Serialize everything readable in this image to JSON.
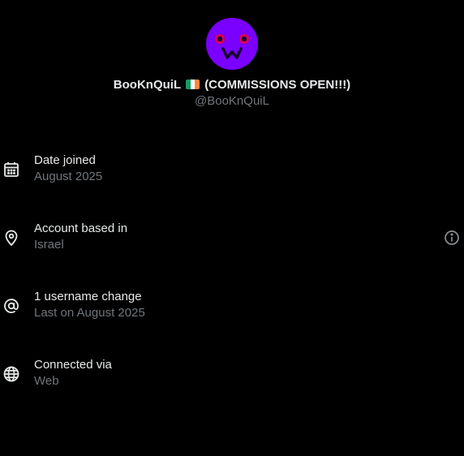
{
  "profile": {
    "display_name_before": "BooKnQuiL",
    "flag_icon": "ireland-flag-icon",
    "display_name_after": "(COMMISSIONS OPEN!!!)",
    "handle": "@BooKnQuiL",
    "avatar_color": "#7a00ff"
  },
  "about": {
    "rows": [
      {
        "icon": "calendar-icon",
        "label": "Date joined",
        "value": "August 2025"
      },
      {
        "icon": "location-pin-icon",
        "label": "Account based in",
        "value": "Israel",
        "info_icon": "info-icon"
      },
      {
        "icon": "at-sign-icon",
        "label": "1 username change",
        "value": "Last on August 2025"
      },
      {
        "icon": "globe-icon",
        "label": "Connected via",
        "value": "Web"
      }
    ]
  },
  "colors": {
    "background": "#000000",
    "primary_text": "#e7e9ea",
    "secondary_text": "#71767b"
  }
}
